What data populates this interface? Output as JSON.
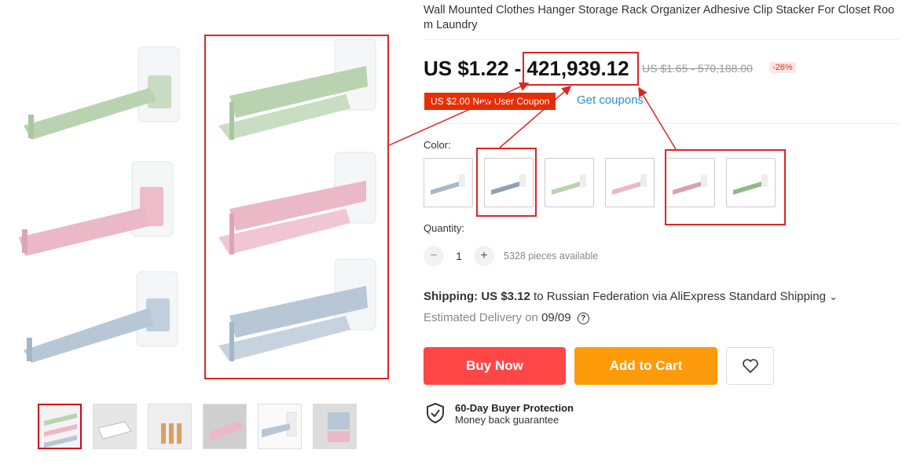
{
  "product": {
    "title": "Wall Mounted Clothes Hanger Storage Rack Organizer Adhesive Clip Stacker For Closet Room Laundry"
  },
  "price": {
    "currency_prefix": "US $1.22 - ",
    "high": "421,939.12",
    "original": "US $1.65 - 570,188.00",
    "discount": "-26%"
  },
  "coupon": {
    "badge": "US $2.00 New User Coupon",
    "link": "Get coupons"
  },
  "color": {
    "label": "Color:",
    "options": [
      "blue-grey",
      "blue-grey",
      "green",
      "pink",
      "pink",
      "green"
    ]
  },
  "quantity": {
    "label": "Quantity:",
    "minus": "−",
    "value": "1",
    "plus": "+",
    "available": "5328 pieces available"
  },
  "shipping": {
    "label": "Shipping:",
    "cost": "US $3.12",
    "destination": "to Russian Federation via AliExpress Standard Shipping",
    "chevron": "⌄"
  },
  "delivery": {
    "label": "Estimated Delivery on",
    "date": "09/09",
    "help": "?"
  },
  "actions": {
    "buy_now": "Buy Now",
    "add_to_cart": "Add to Cart"
  },
  "protection": {
    "title": "60-Day Buyer Protection",
    "subtitle": "Money back guarantee"
  },
  "colors": {
    "accent_red": "#ff4747",
    "cart_orange": "#fe9b0b",
    "annotation": "#e02424",
    "hanger_green": "#b9d3b1",
    "hanger_pink": "#eab8c6",
    "hanger_blue": "#b7c7d6"
  }
}
